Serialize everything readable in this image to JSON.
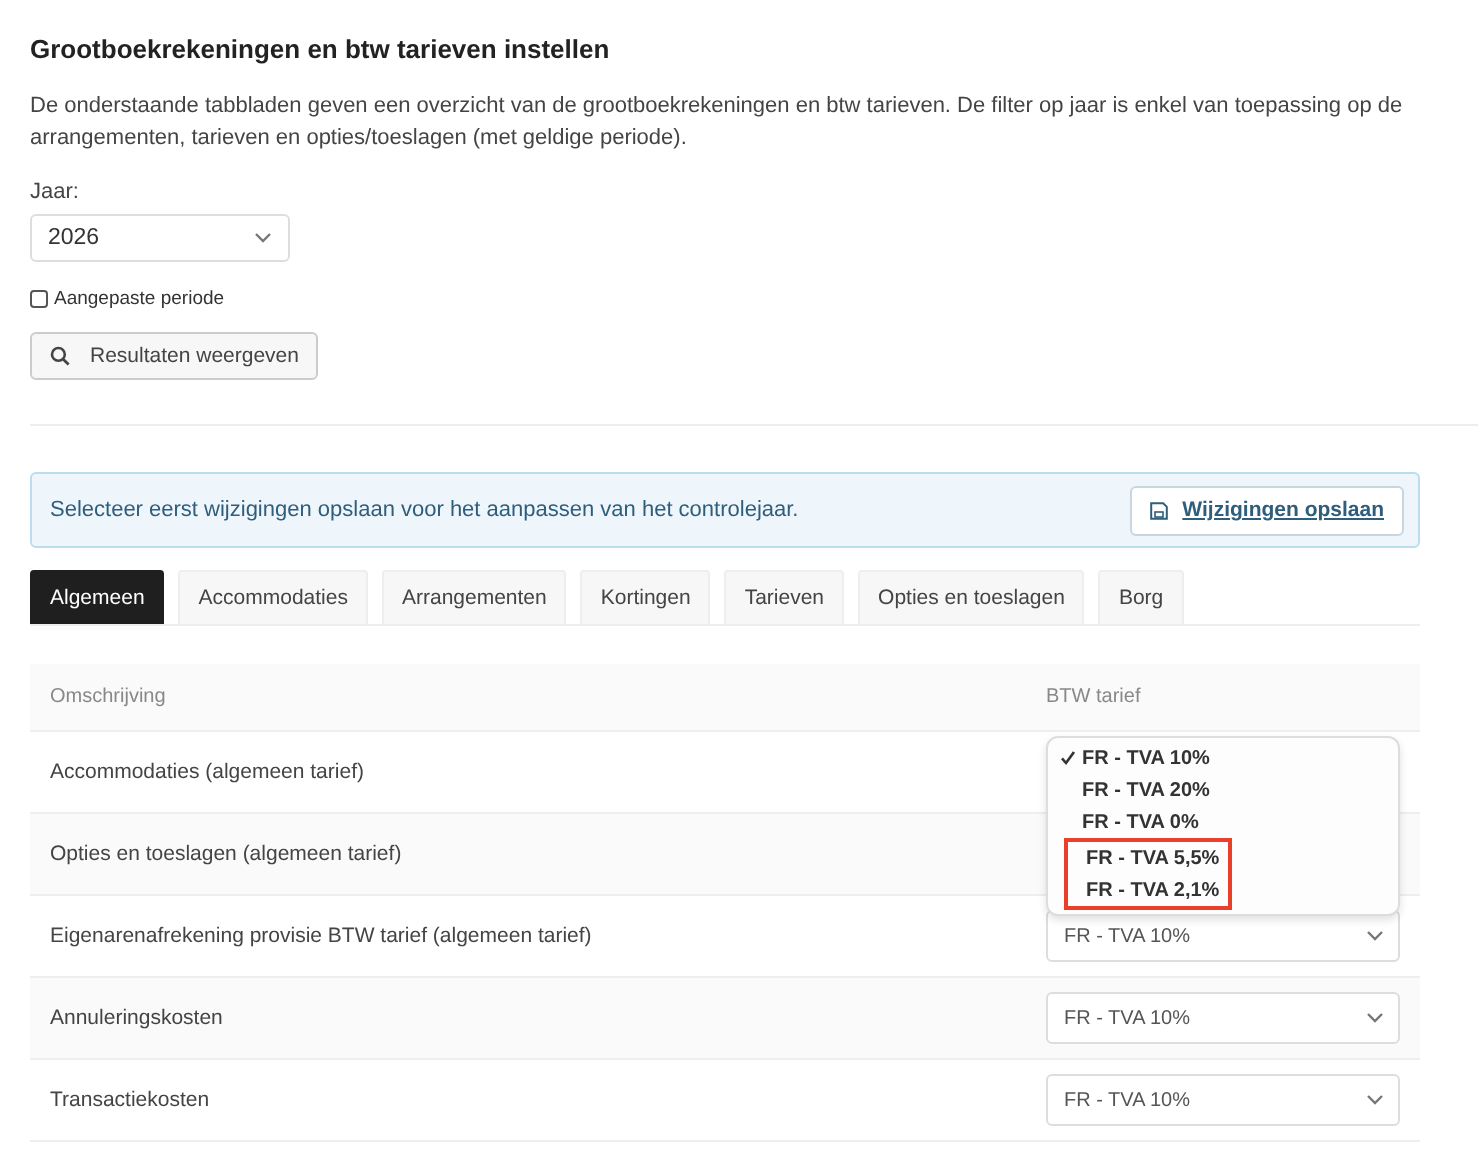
{
  "title": "Grootboekrekeningen en btw tarieven instellen",
  "intro": "De onderstaande tabbladen geven een overzicht van de grootboekrekeningen en btw tarieven. De filter op jaar is enkel van toepassing op de arrangementen, tarieven en opties/toeslagen (met geldige periode).",
  "year_filter": {
    "label": "Jaar:",
    "value": "2026"
  },
  "custom_period": {
    "label": "Aangepaste periode",
    "checked": false
  },
  "show_results_button": "Resultaten weergeven",
  "alert": {
    "message": "Selecteer eerst wijzigingen opslaan voor het aanpassen van het controlejaar.",
    "button": "Wijzigingen opslaan"
  },
  "tabs": [
    {
      "label": "Algemeen",
      "selected": true
    },
    {
      "label": "Accommodaties",
      "selected": false
    },
    {
      "label": "Arrangementen",
      "selected": false
    },
    {
      "label": "Kortingen",
      "selected": false
    },
    {
      "label": "Tarieven",
      "selected": false
    },
    {
      "label": "Opties en toeslagen",
      "selected": false
    },
    {
      "label": "Borg",
      "selected": false
    }
  ],
  "table": {
    "columns": [
      "Omschrijving",
      "BTW tarief"
    ],
    "rows": [
      {
        "description": "Accommodaties (algemeen tarief)"
      },
      {
        "description": "Opties en toeslagen (algemeen tarief)"
      },
      {
        "description": "Eigenarenafrekening provisie BTW tarief (algemeen tarief)",
        "rate": "FR - TVA 10%"
      },
      {
        "description": "Annuleringskosten",
        "rate": "FR - TVA 10%"
      },
      {
        "description": "Transactiekosten",
        "rate": "FR - TVA 10%"
      }
    ]
  },
  "rate_dropdown": {
    "options": [
      {
        "label": "FR - TVA 10%",
        "selected": true,
        "highlighted": false
      },
      {
        "label": "FR - TVA 20%",
        "selected": false,
        "highlighted": false
      },
      {
        "label": "FR - TVA 0%",
        "selected": false,
        "highlighted": false
      },
      {
        "label": "FR - TVA 5,5%",
        "selected": false,
        "highlighted": true
      },
      {
        "label": "FR - TVA 2,1%",
        "selected": false,
        "highlighted": true
      }
    ]
  }
}
